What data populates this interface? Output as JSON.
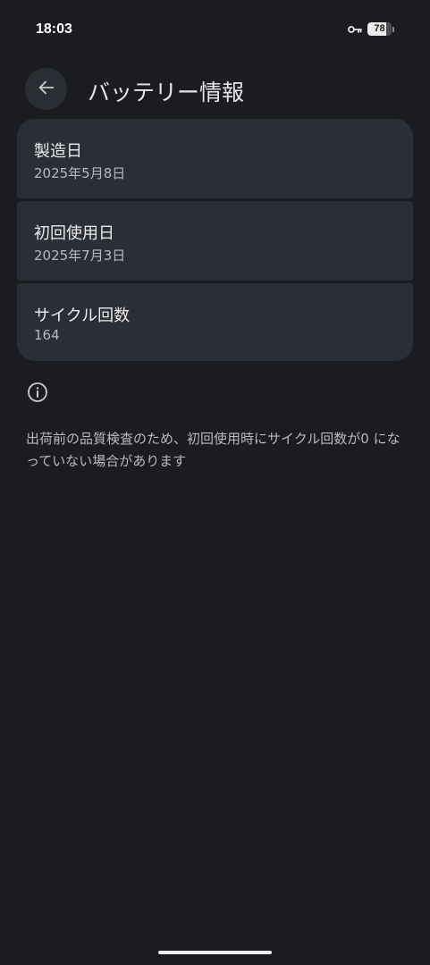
{
  "status_bar": {
    "time": "18:03",
    "battery_level": "78",
    "battery_fraction": 0.78,
    "key_icon": "vpn-key-icon"
  },
  "header": {
    "back_icon": "arrow-back-icon",
    "title": "バッテリー情報"
  },
  "items": [
    {
      "label": "製造日",
      "value": "2025年5月8日"
    },
    {
      "label": "初回使用日",
      "value": "2025年7月3日"
    },
    {
      "label": "サイクル回数",
      "value": "164"
    }
  ],
  "info": {
    "icon": "info-icon",
    "text": "出荷前の品質検査のため、初回使用時にサイクル回数が0 になっていない場合があります"
  },
  "colors": {
    "background": "#1a1c21",
    "card": "#2b2e36",
    "primary_text": "#ececef",
    "secondary_text": "#b8bac0"
  }
}
